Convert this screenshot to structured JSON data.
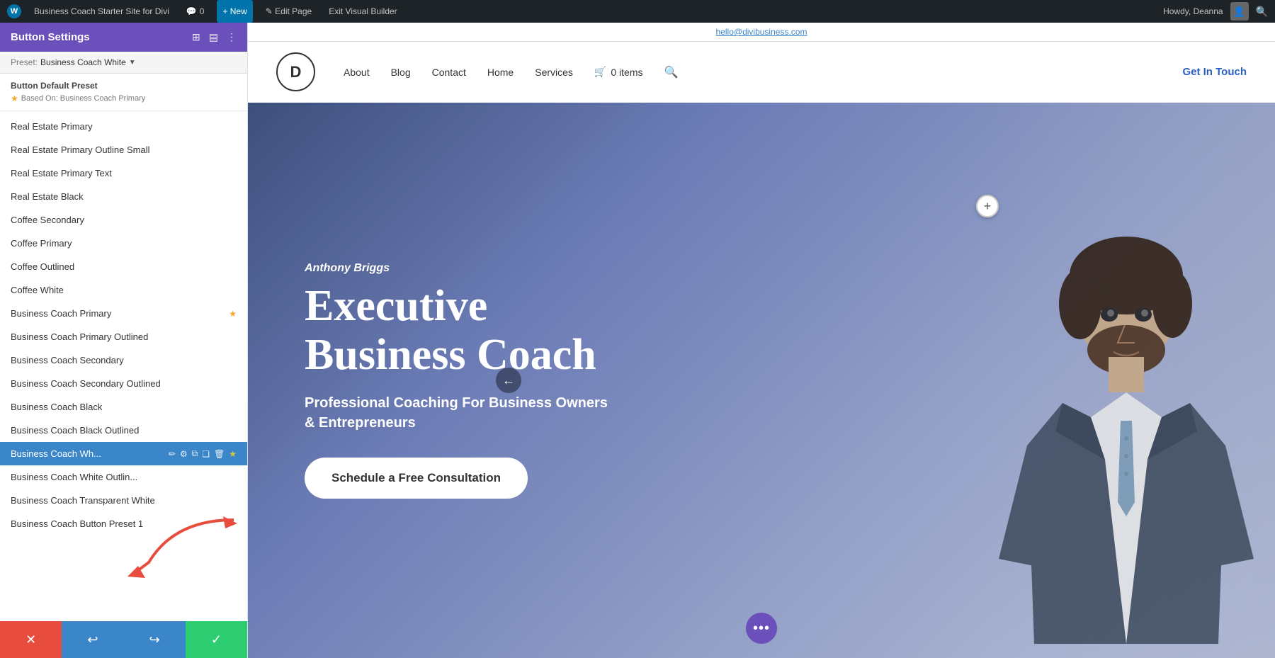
{
  "adminBar": {
    "siteName": "Business Coach Starter Site for Divi",
    "commentCount": "0",
    "newLabel": "+ New",
    "editLabel": "✎ Edit Page",
    "exitLabel": "Exit Visual Builder",
    "greetingLabel": "Howdy, Deanna",
    "wpIcon": "W"
  },
  "leftPanel": {
    "title": "Button Settings",
    "presetLabel": "Preset: Business Coach White",
    "defaultPreset": {
      "title": "Button Default Preset",
      "basedOn": "Based On: Business Coach Primary"
    },
    "presets": [
      {
        "id": 1,
        "label": "Real Estate Primary",
        "active": false
      },
      {
        "id": 2,
        "label": "Real Estate Primary Outline Small",
        "active": false
      },
      {
        "id": 3,
        "label": "Real Estate Primary Text",
        "active": false
      },
      {
        "id": 4,
        "label": "Real Estate Black",
        "active": false
      },
      {
        "id": 5,
        "label": "Coffee Secondary",
        "active": false
      },
      {
        "id": 6,
        "label": "Coffee Primary",
        "active": false
      },
      {
        "id": 7,
        "label": "Coffee Outlined",
        "active": false
      },
      {
        "id": 8,
        "label": "Coffee White",
        "active": false
      },
      {
        "id": 9,
        "label": "Business Coach Primary",
        "active": false,
        "starred": true
      },
      {
        "id": 10,
        "label": "Business Coach Primary Outlined",
        "active": false
      },
      {
        "id": 11,
        "label": "Business Coach Secondary",
        "active": false
      },
      {
        "id": 12,
        "label": "Business Coach Secondary Outlined",
        "active": false
      },
      {
        "id": 13,
        "label": "Business Coach Black",
        "active": false
      },
      {
        "id": 14,
        "label": "Business Coach Black Outlined",
        "active": false
      },
      {
        "id": 15,
        "label": "Business Coach Wh...",
        "active": true,
        "isActive": true
      },
      {
        "id": 16,
        "label": "Business Coach White Outlin...",
        "active": false
      },
      {
        "id": 17,
        "label": "Business Coach Transparent White",
        "active": false
      },
      {
        "id": 18,
        "label": "Business Coach Button Preset 1",
        "active": false
      }
    ],
    "bottomBar": {
      "cancelIcon": "✕",
      "undoIcon": "↩",
      "redoIcon": "↪",
      "confirmIcon": "✓"
    }
  },
  "siteTopbar": {
    "email": "hello@divibusiness.com"
  },
  "siteNav": {
    "logoText": "D",
    "items": [
      "About",
      "Blog",
      "Contact",
      "Home",
      "Services"
    ],
    "cartLabel": "0 items",
    "getInTouchLabel": "Get In Touch"
  },
  "hero": {
    "name": "Anthony Briggs",
    "title": "Executive Business Coach",
    "subtitle": "Professional Coaching For Business Owners & Entrepreneurs",
    "ctaLabel": "Schedule a Free Consultation"
  },
  "icons": {
    "pencil": "✏",
    "gear": "⚙",
    "copy": "⧉",
    "pages": "❑",
    "trash": "🗑",
    "star": "★",
    "starEmpty": "☆",
    "plus": "+",
    "arrowLeft": "←",
    "dotsMenu": "•••",
    "search": "🔍",
    "cart": "🛒"
  }
}
